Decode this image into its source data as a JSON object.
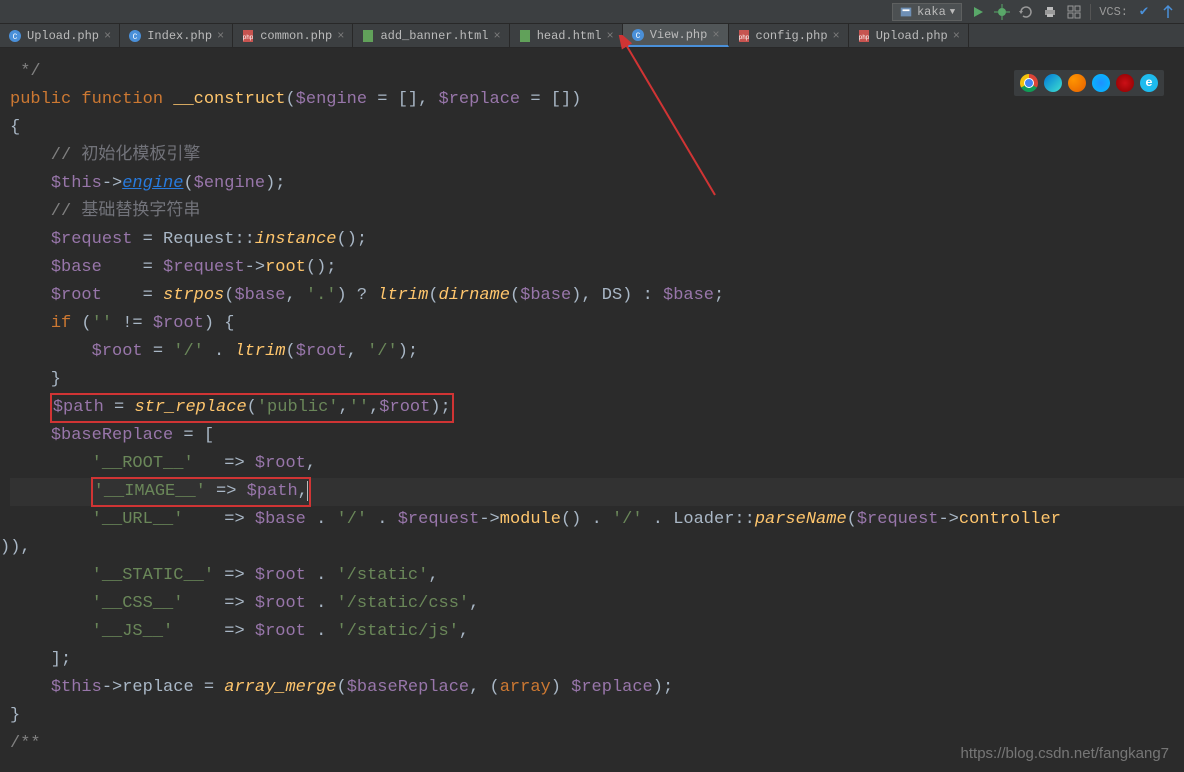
{
  "toolbar": {
    "run_config": "kaka",
    "vcs_label": "VCS:"
  },
  "tabs": [
    {
      "icon": "php",
      "label": "Upload.php",
      "active": false
    },
    {
      "icon": "php",
      "label": "Index.php",
      "active": false
    },
    {
      "icon": "php-red",
      "label": "common.php",
      "active": false
    },
    {
      "icon": "html",
      "label": "add_banner.html",
      "active": false
    },
    {
      "icon": "html",
      "label": "head.html",
      "active": false
    },
    {
      "icon": "php",
      "label": "View.php",
      "active": true
    },
    {
      "icon": "php-red",
      "label": "config.php",
      "active": false
    },
    {
      "icon": "php-red",
      "label": "Upload.php",
      "active": false
    }
  ],
  "code": {
    "l0": " */",
    "l1_kw1": "public",
    "l1_kw2": "function",
    "l1_fn": "__construct",
    "l1_rest": "(",
    "l1_v1": "$engine",
    "l1_eq": " = [], ",
    "l1_v2": "$replace",
    "l1_end": " = [])",
    "l2": "{",
    "l3_c": "    // ",
    "l3_cn": "初始化模板引擎",
    "l4_a": "    ",
    "l4_v": "$this",
    "l4_arrow": "->",
    "l4_link": "engine",
    "l4_p": "(",
    "l4_v2": "$engine",
    "l4_end": ");",
    "l5_c": "    // ",
    "l5_cn": "基础替换字符串",
    "l6_a": "    ",
    "l6_v": "$request",
    "l6_eq": " = ",
    "l6_cls": "Request",
    "l6_dd": "::",
    "l6_m": "instance",
    "l6_end": "();",
    "l7_a": "    ",
    "l7_v": "$base",
    "l7_sp": "    = ",
    "l7_v2": "$request",
    "l7_arrow": "->",
    "l7_m": "root",
    "l7_end": "();",
    "l8_a": "    ",
    "l8_v": "$root",
    "l8_sp": "    = ",
    "l8_fn": "strpos",
    "l8_p1": "(",
    "l8_v2": "$base",
    "l8_c": ", ",
    "l8_s": "'.'",
    "l8_q": ") ? ",
    "l8_fn2": "ltrim",
    "l8_p2": "(",
    "l8_fn3": "dirname",
    "l8_p3": "(",
    "l8_v3": "$base",
    "l8_p4": "), DS) : ",
    "l8_v4": "$base",
    "l8_end": ";",
    "l9_a": "    ",
    "l9_kw": "if",
    "l9_p": " (",
    "l9_s": "''",
    "l9_ne": " != ",
    "l9_v": "$root",
    "l9_end": ") {",
    "l10_a": "        ",
    "l10_v": "$root",
    "l10_eq": " = ",
    "l10_s": "'/'",
    "l10_d": " . ",
    "l10_fn": "ltrim",
    "l10_p": "(",
    "l10_v2": "$root",
    "l10_c": ", ",
    "l10_s2": "'/'",
    "l10_end": ");",
    "l11": "    }",
    "l12_a": "    ",
    "l12_v": "$path",
    "l12_eq": " = ",
    "l12_fn": "str_replace",
    "l12_p": "(",
    "l12_s1": "'public'",
    "l12_c1": ",",
    "l12_s2": "''",
    "l12_c2": ",",
    "l12_v2": "$root",
    "l12_end": ");",
    "l13_a": "    ",
    "l13_v": "$baseReplace",
    "l13_eq": " = [",
    "l14_a": "        ",
    "l14_s": "'__ROOT__'",
    "l14_sp": "   => ",
    "l14_v": "$root",
    "l14_end": ",",
    "l15_a": "        ",
    "l15_s": "'__IMAGE__'",
    "l15_sp": " => ",
    "l15_v": "$path",
    "l15_end": ",",
    "l16_a": "        ",
    "l16_s": "'__URL__'",
    "l16_sp": "    => ",
    "l16_v": "$base",
    "l16_d": " . ",
    "l16_s2": "'/'",
    "l16_d2": " . ",
    "l16_v2": "$request",
    "l16_arrow": "->",
    "l16_m": "module",
    "l16_p": "()",
    "l16_d3": " . ",
    "l16_s3": "'/'",
    "l16_d4": " . ",
    "l16_cls": "Loader",
    "l16_dd": "::",
    "l16_m2": "parseName",
    "l16_p2": "(",
    "l16_v3": "$request",
    "l16_arrow2": "->",
    "l16_m3": "controller",
    "l17": ")),",
    "l18_a": "        ",
    "l18_s": "'__STATIC__'",
    "l18_sp": " => ",
    "l18_v": "$root",
    "l18_d": " . ",
    "l18_s2": "'/static'",
    "l18_end": ",",
    "l19_a": "        ",
    "l19_s": "'__CSS__'",
    "l19_sp": "    => ",
    "l19_v": "$root",
    "l19_d": " . ",
    "l19_s2": "'/static/css'",
    "l19_end": ",",
    "l20_a": "        ",
    "l20_s": "'__JS__'",
    "l20_sp": "     => ",
    "l20_v": "$root",
    "l20_d": " . ",
    "l20_s2": "'/static/js'",
    "l20_end": ",",
    "l21": "    ];",
    "l22_a": "    ",
    "l22_v": "$this",
    "l22_arrow": "->",
    "l22_p": "replace = ",
    "l22_fn": "array_merge",
    "l22_p2": "(",
    "l22_v2": "$baseReplace",
    "l22_c": ", (",
    "l22_kw": "array",
    "l22_p3": ") ",
    "l22_v3": "$replace",
    "l22_end": ");",
    "l23": "}",
    "l24": "",
    "l25": "/**"
  },
  "watermark": "https://blog.csdn.net/fangkang7"
}
